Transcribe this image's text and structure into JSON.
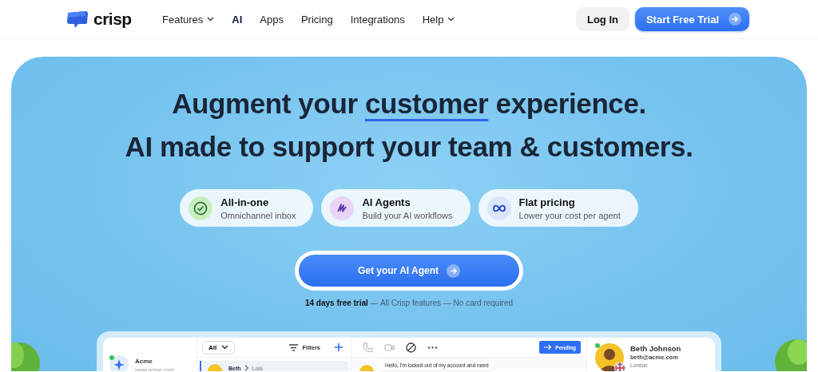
{
  "nav": {
    "logo": "crisp",
    "links": [
      {
        "label": "Features",
        "dropdown": true,
        "selected": false
      },
      {
        "label": "AI",
        "dropdown": false,
        "selected": true
      },
      {
        "label": "Apps",
        "dropdown": false,
        "selected": false
      },
      {
        "label": "Pricing",
        "dropdown": false,
        "selected": false
      },
      {
        "label": "Integrations",
        "dropdown": false,
        "selected": false
      },
      {
        "label": "Help",
        "dropdown": true,
        "selected": false
      }
    ],
    "login": "Log In",
    "trial": "Start Free Trial"
  },
  "hero": {
    "headline": [
      [
        {
          "text": "Augment your ",
          "underlined": false
        },
        {
          "text": "customer",
          "underlined": true
        },
        {
          "text": " experience.",
          "underlined": false
        }
      ],
      [
        {
          "text": "AI made to support your team & customers.",
          "underlined": false
        }
      ]
    ],
    "features": [
      {
        "kind": "check",
        "title": "All-in-one",
        "subtitle": "Omnichannel inbox"
      },
      {
        "kind": "agents",
        "title": "AI Agents",
        "subtitle": "Build your AI workflows"
      },
      {
        "kind": "infinity",
        "title": "Flat pricing",
        "subtitle": "Lower your cost per agent"
      }
    ],
    "cta": "Get your AI Agent",
    "note": "**14 days free trial** — All Crisp features — No card required"
  },
  "app": {
    "workspace": {
      "name": "Acme",
      "url": "www.acme.com"
    },
    "filter": "All",
    "filters": "Filters",
    "conversation": {
      "name": "Beth",
      "agent": "Lola"
    },
    "status": "Pending",
    "message": "Hello, I'm locked out of my account and need",
    "contact": {
      "name": "Beth Johnson",
      "email": "beth@acme.com",
      "location": "London"
    }
  }
}
